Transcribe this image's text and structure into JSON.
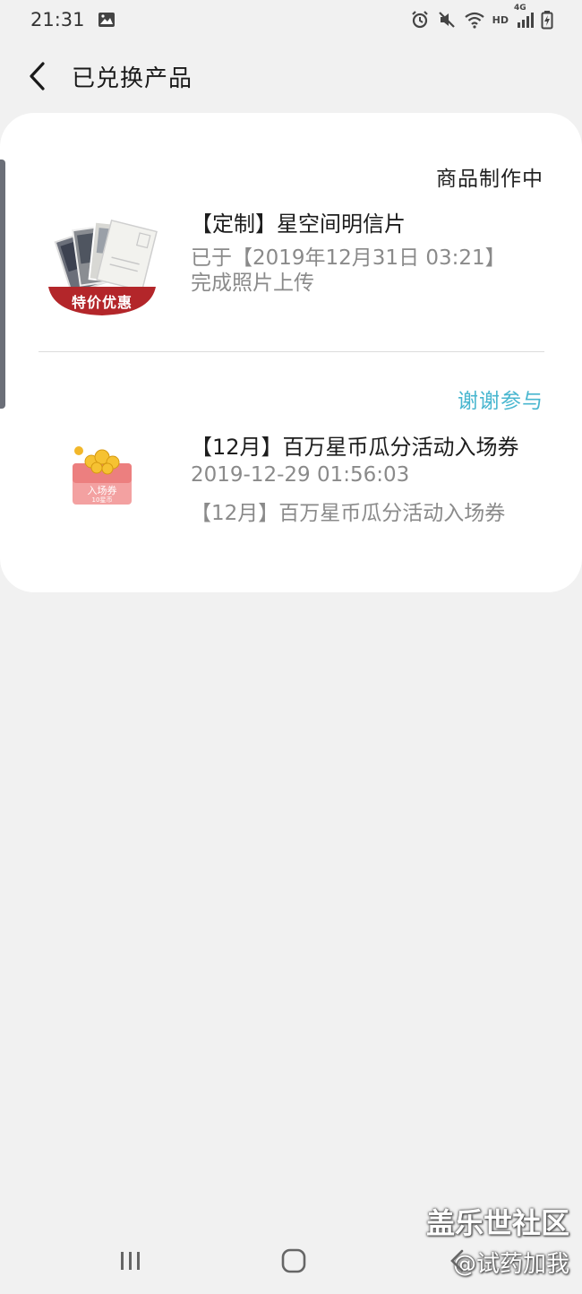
{
  "status_bar": {
    "time": "21:31",
    "net_label": "HD",
    "signal_label": "4G"
  },
  "header": {
    "title": "已兑换产品"
  },
  "items": [
    {
      "status": "商品制作中",
      "title": "【定制】星空间明信片",
      "line1": "已于【2019年12月31日 03:21】",
      "line2": "完成照片上传",
      "badge": "特价优惠"
    },
    {
      "status": "谢谢参与",
      "title": "【12月】百万星币瓜分活动入场券",
      "line1": "2019-12-29 01:56:03",
      "line2": "【12月】百万星币瓜分活动入场券",
      "ticket_label": "入场券",
      "ticket_sub": "10星币"
    }
  ],
  "colors": {
    "background": "#f1f1f1",
    "card": "#ffffff",
    "accent_teal": "#48b6cf",
    "badge_red": "#b3262a"
  },
  "watermark": {
    "line1": "盖乐世社区",
    "line2": "@试药加我"
  }
}
